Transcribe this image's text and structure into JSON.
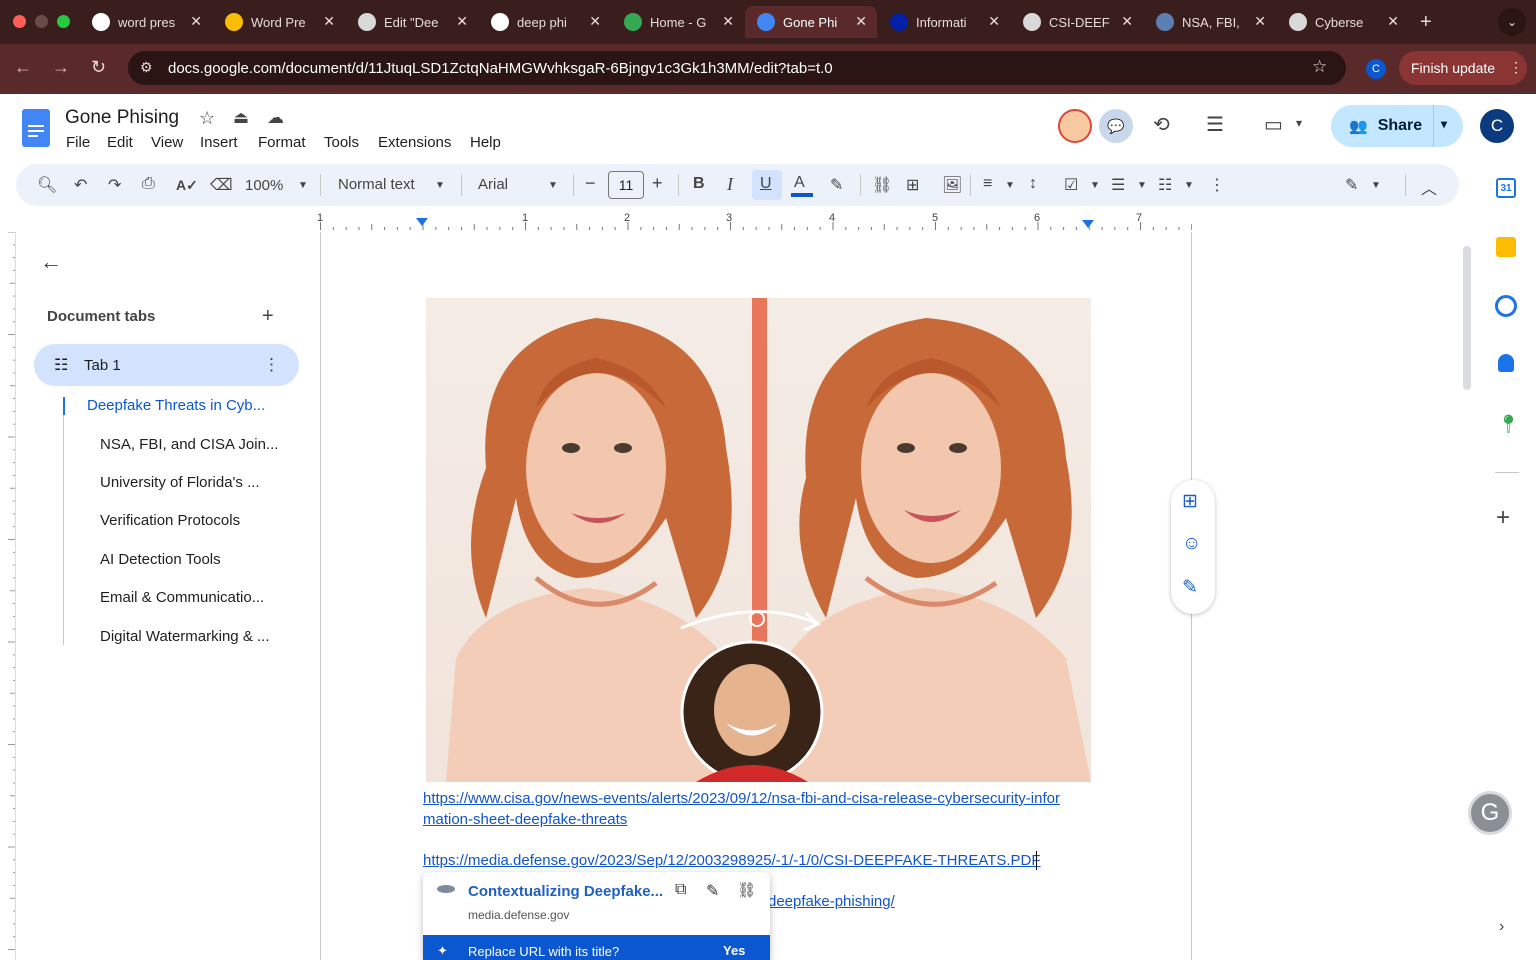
{
  "browser": {
    "tabs": [
      {
        "title": "word pres",
        "icon": "google-icon"
      },
      {
        "title": "Word Pre",
        "icon": "slides-icon"
      },
      {
        "title": "Edit \"Dee",
        "icon": "wordpress-icon"
      },
      {
        "title": "deep phi",
        "icon": "google-icon"
      },
      {
        "title": "Home - G",
        "icon": "drive-icon"
      },
      {
        "title": "Gone Phi",
        "icon": "docs-icon"
      },
      {
        "title": "Informati",
        "icon": "uf-icon"
      },
      {
        "title": "CSI-DEEF",
        "icon": "globe-icon"
      },
      {
        "title": "NSA, FBI,",
        "icon": "cisa-icon"
      },
      {
        "title": "Cyberse",
        "icon": "chatgpt-icon"
      }
    ],
    "url": "docs.google.com/document/d/11JtuqLSD1ZctqNaHMGWvhksgaR-6Bjngv1c3Gk1h3MM/edit?tab=t.0",
    "profile_letter": "C",
    "finish_update": "Finish update"
  },
  "docs": {
    "title": "Gone Phising",
    "menus": [
      "File",
      "Edit",
      "View",
      "Insert",
      "Format",
      "Tools",
      "Extensions",
      "Help"
    ],
    "share_label": "Share",
    "account_letter": "C",
    "toolbar": {
      "zoom": "100%",
      "style": "Normal text",
      "font": "Arial",
      "font_size": "11"
    },
    "ruler_numbers": [
      "1",
      "1",
      "2",
      "3",
      "4",
      "5",
      "6",
      "7"
    ],
    "sidebar": {
      "heading": "Document tabs",
      "tab_label": "Tab 1",
      "outline": [
        "Deepfake Threats in Cyb...",
        "NSA, FBI, and CISA Join...",
        "University of Florida's ...",
        "Verification Protocols",
        "AI Detection Tools",
        "Email & Communicatio...",
        "Digital Watermarking & ..."
      ]
    },
    "body": {
      "link1_line1": "https://www.cisa.gov/news-events/alerts/2023/09/12/nsa-fbi-and-cisa-release-cybersecurity-infor",
      "link1_line2": "mation-sheet-deepfake-threats",
      "link2": "https://media.defense.gov/2023/Sep/12/2003298925/-1/-1/0/CSI-DEEPFAKE-THREATS.PDF",
      "link3_tail": "deepfake-phishing/"
    },
    "link_popup": {
      "title": "Contextualizing Deepfake...",
      "domain": "media.defense.gov",
      "suggestion": "Replace URL with its title?",
      "action": "Yes"
    }
  },
  "colors": {
    "tabstrip": "#3a1d1d",
    "toolbar": "#5a2a2a",
    "accent": "#0b57d0",
    "share_bg": "#c2e7ff",
    "nav_selected": "#d3e3fd"
  }
}
